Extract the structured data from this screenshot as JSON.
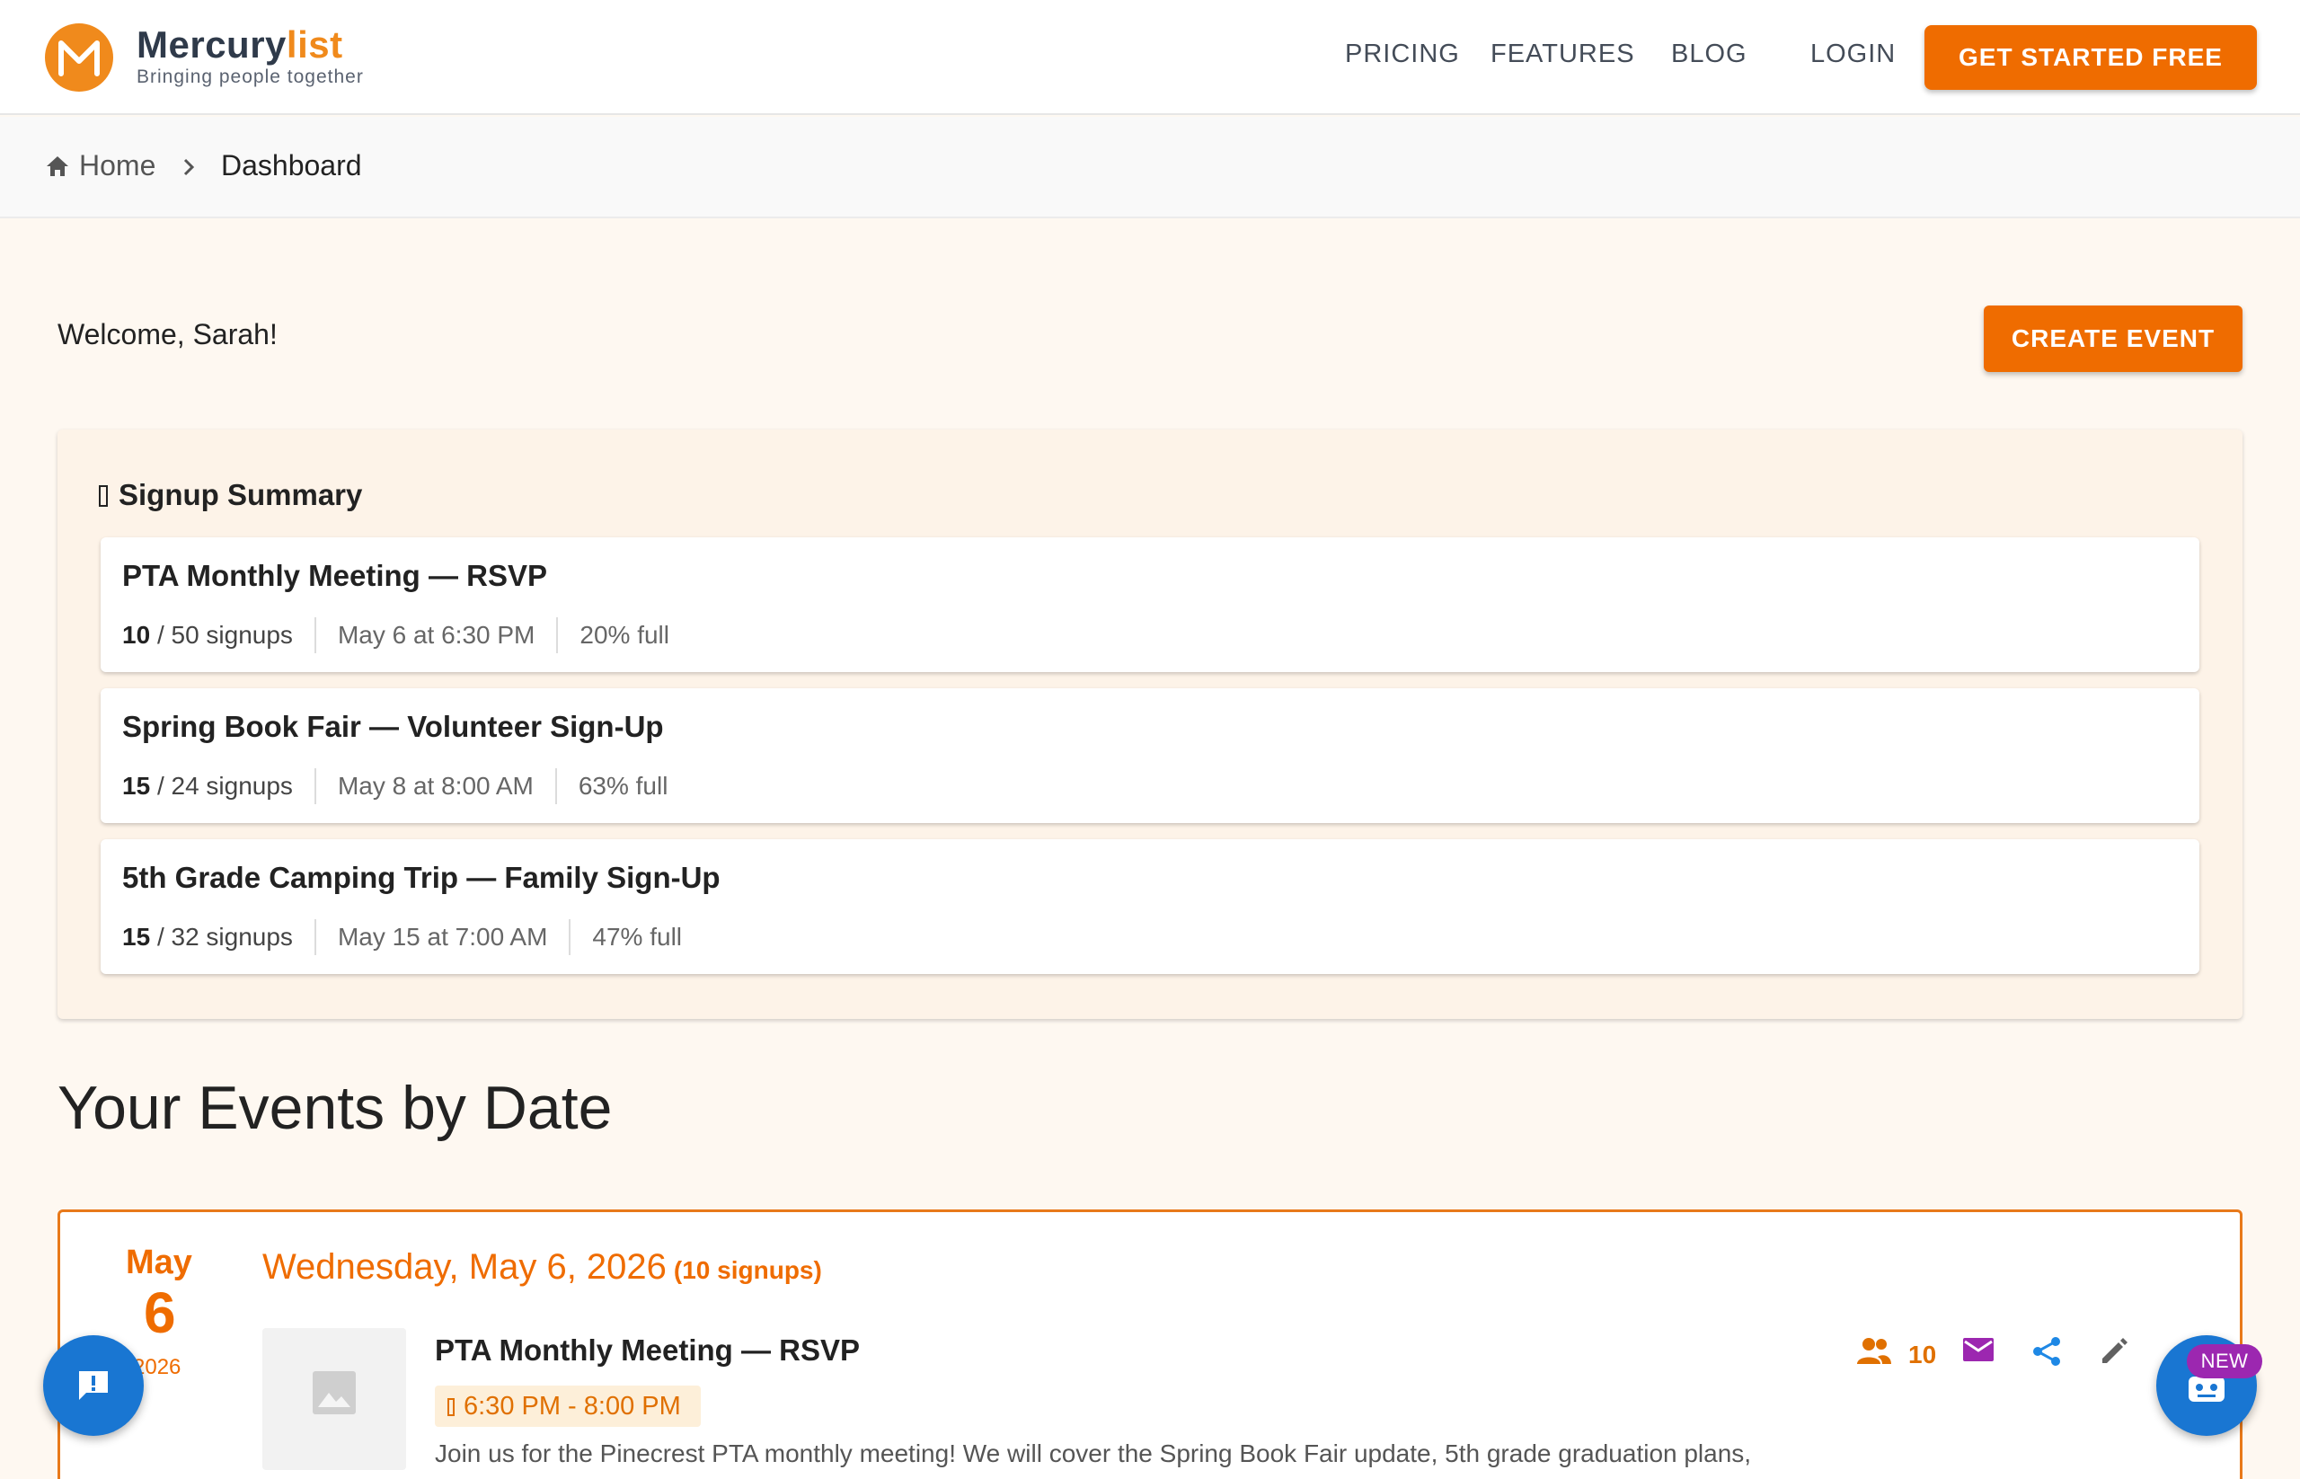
{
  "header": {
    "brand_part1": "Mercury",
    "brand_part2": "list",
    "tagline": "Bringing people together",
    "nav": [
      "PRICING",
      "FEATURES",
      "BLOG"
    ],
    "login": "LOGIN",
    "cta": "GET STARTED FREE"
  },
  "breadcrumb": {
    "home": "Home",
    "current": "Dashboard"
  },
  "welcome": {
    "text": "Welcome, Sarah!",
    "create_event": "CREATE EVENT"
  },
  "summary": {
    "title": "Signup Summary",
    "items": [
      {
        "title": "PTA Monthly Meeting — RSVP",
        "filled": "10",
        "capacity": "/ 50 signups",
        "date": "May 6 at 6:30 PM",
        "full": "20% full"
      },
      {
        "title": "Spring Book Fair — Volunteer Sign-Up",
        "filled": "15",
        "capacity": "/ 24 signups",
        "date": "May 8 at 8:00 AM",
        "full": "63% full"
      },
      {
        "title": "5th Grade Camping Trip — Family Sign-Up",
        "filled": "15",
        "capacity": "/ 32 signups",
        "date": "May 15 at 7:00 AM",
        "full": "47% full"
      }
    ]
  },
  "events": {
    "heading": "Your Events by Date",
    "groups": [
      {
        "month": "May",
        "day": "6",
        "year": "2026",
        "heading": "Wednesday, May 6, 2026",
        "count": "(10 signups)",
        "items": [
          {
            "title": "PTA Monthly Meeting — RSVP",
            "time": "6:30 PM - 8:00 PM",
            "description": "Join us for the Pinecrest PTA monthly meeting! We will cover the Spring Book Fair update, 5th grade graduation plans,",
            "people_count": "10"
          }
        ]
      }
    ]
  },
  "badges": {
    "new": "NEW"
  },
  "colors": {
    "accent": "#ef6c00",
    "brand_orange": "#f08a1c",
    "fab_blue": "#1976d2",
    "badge_purple": "#9c27b0"
  }
}
